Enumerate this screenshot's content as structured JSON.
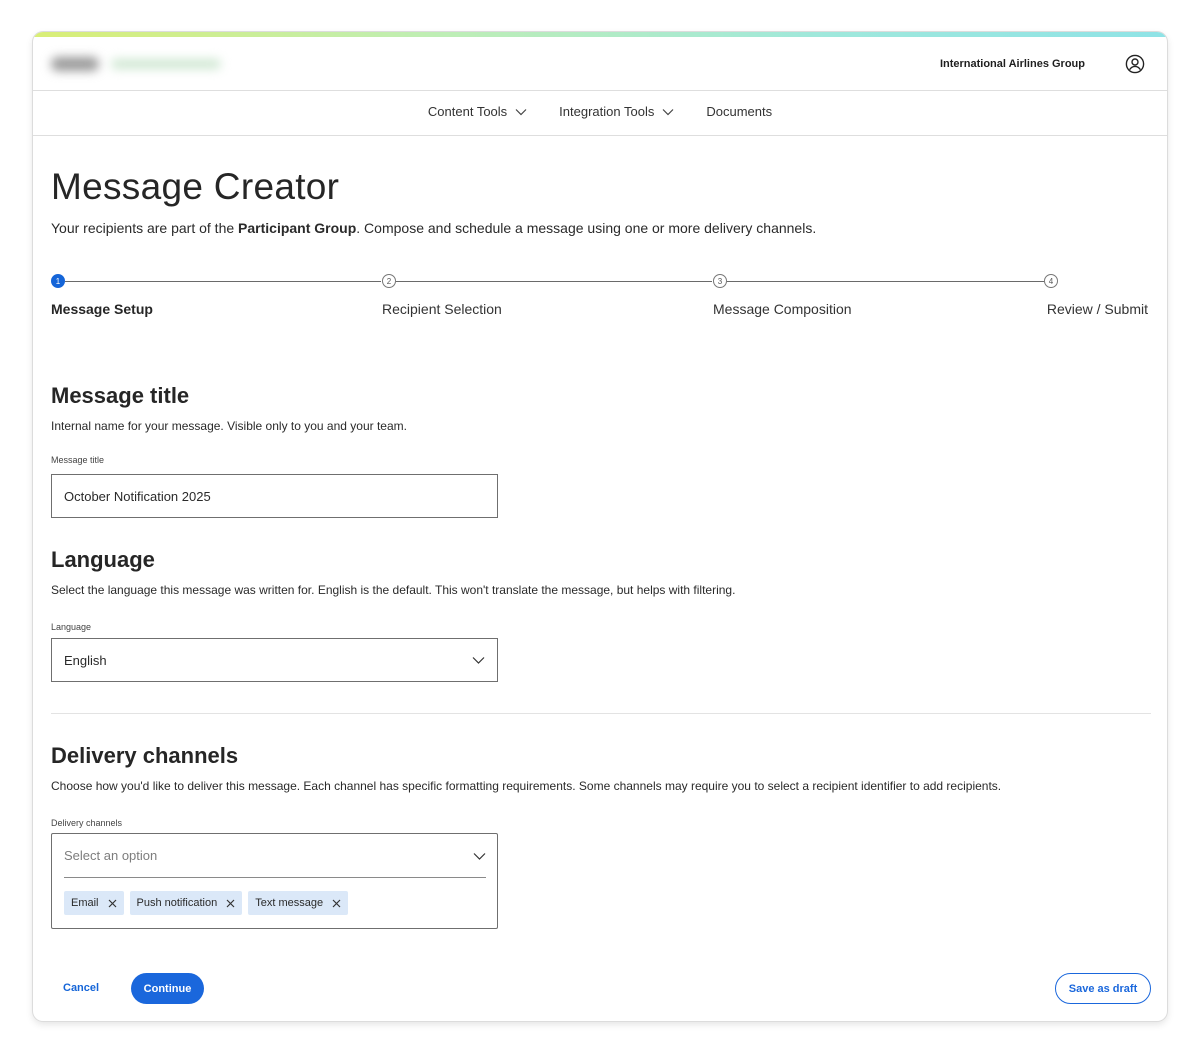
{
  "header": {
    "org_name": "International Airlines Group",
    "account_icon": "user-circle-icon"
  },
  "nav": {
    "items": [
      {
        "label": "Content Tools",
        "has_dropdown": true
      },
      {
        "label": "Integration Tools",
        "has_dropdown": true
      },
      {
        "label": "Documents",
        "has_dropdown": false
      }
    ]
  },
  "page": {
    "title": "Message Creator",
    "intro_before": "Your recipients are part of the ",
    "intro_bold": "Participant Group",
    "intro_after": ". Compose and schedule a message using one or more delivery channels."
  },
  "stepper": {
    "steps": [
      {
        "number": "1",
        "label": "Message Setup",
        "active": true
      },
      {
        "number": "2",
        "label": "Recipient Selection",
        "active": false
      },
      {
        "number": "3",
        "label": "Message Composition",
        "active": false
      },
      {
        "number": "4",
        "label": "Review / Submit",
        "active": false
      }
    ]
  },
  "message_title_section": {
    "heading": "Message title",
    "description": "Internal name for your message. Visible only to you and your team.",
    "field_label": "Message title",
    "value": "October Notification 2025"
  },
  "language_section": {
    "heading": "Language",
    "description": "Select the language this message was written for. English is the default. This won't translate the message, but helps with filtering.",
    "field_label": "Language",
    "selected": "English"
  },
  "delivery_section": {
    "heading": "Delivery channels",
    "description": "Choose how you'd like to deliver this message. Each channel has specific formatting requirements. Some channels may require you to select a recipient identifier to add recipients.",
    "field_label": "Delivery channels",
    "placeholder": "Select an option",
    "chips": [
      "Email",
      "Push notification",
      "Text message"
    ]
  },
  "actions": {
    "cancel": "Cancel",
    "continue": "Continue",
    "save_draft": "Save as draft"
  },
  "colors": {
    "primary": "#1a67dc",
    "chip_bg": "#dbe8f8",
    "step_active": "#1565d8"
  }
}
